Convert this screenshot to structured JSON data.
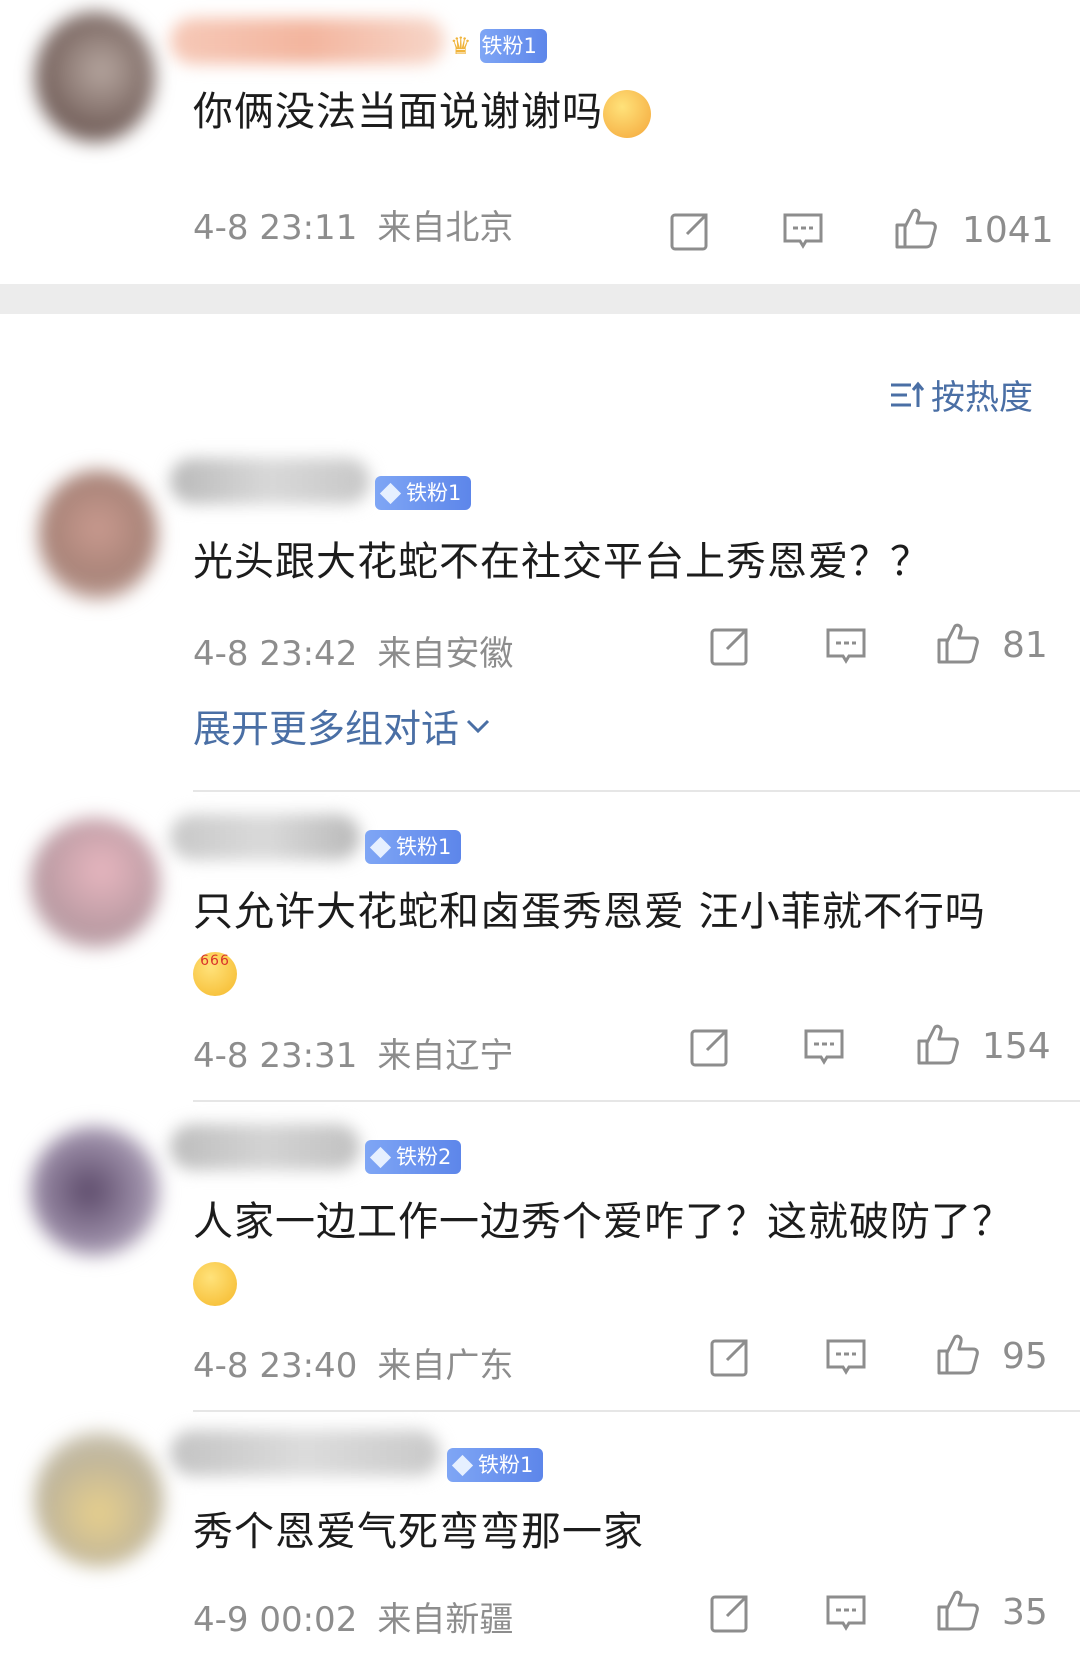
{
  "top_comment": {
    "badge": "铁粉1",
    "text": "你俩没法当面说谢谢吗",
    "date": "4-8 23:11",
    "location": "来自北京",
    "likes": "1041",
    "emoji": "yum-emoji"
  },
  "sort": {
    "label": "按热度",
    "icon": "sort-icon"
  },
  "comments": [
    {
      "badge": "铁粉1",
      "text": "光头跟大花蛇不在社交平台上秀恩爱？？",
      "date": "4-8 23:42",
      "location": "来自安徽",
      "likes": "81"
    },
    {
      "badge": "铁粉1",
      "text": "只允许大花蛇和卤蛋秀恩爱 汪小菲就不行吗",
      "emoji_label": "666",
      "date": "4-8 23:31",
      "location": "来自辽宁",
      "likes": "154"
    },
    {
      "badge": "铁粉2",
      "text": "人家一边工作一边秀个爱咋了？这就破防了？",
      "date": "4-8 23:40",
      "location": "来自广东",
      "likes": "95"
    },
    {
      "badge": "铁粉1",
      "text": "秀个恩爱气死弯弯那一家",
      "date": "4-9 00:02",
      "location": "来自新疆",
      "likes": "35"
    }
  ],
  "expand_label": "展开更多组对话",
  "colors": {
    "link": "#4a6fa5",
    "meta": "#8d8d8d",
    "badge": "#6b8ff0",
    "divider": "#e6e6e6",
    "section_gap": "#ececec"
  }
}
